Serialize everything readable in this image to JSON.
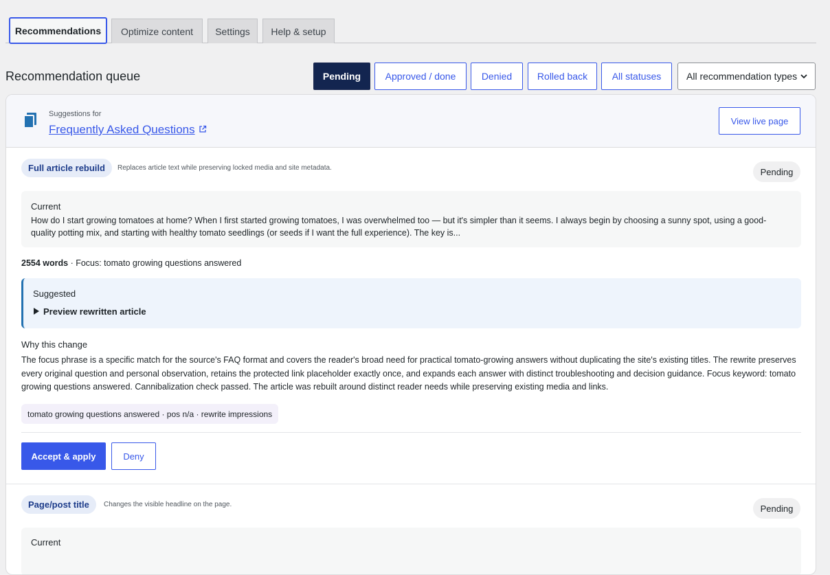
{
  "tabs": [
    {
      "label": "Recommendations",
      "active": true
    },
    {
      "label": "Optimize content",
      "active": false
    },
    {
      "label": "Settings",
      "active": false
    },
    {
      "label": "Help & setup",
      "active": false
    }
  ],
  "queue": {
    "title": "Recommendation queue",
    "filters": [
      {
        "label": "Pending",
        "active": true
      },
      {
        "label": "Approved / done",
        "active": false
      },
      {
        "label": "Denied",
        "active": false
      },
      {
        "label": "Rolled back",
        "active": false
      },
      {
        "label": "All statuses",
        "active": false
      }
    ],
    "type_select": {
      "value": "All recommendation types",
      "icon": "chevron-down-icon"
    }
  },
  "card": {
    "suggestions_for": "Suggestions for",
    "page_title": "Frequently Asked Questions",
    "page_icon": "copy-pages-icon",
    "view_live_label": "View live page",
    "recommendations": [
      {
        "type_label": "Full article rebuild",
        "type_desc": "Replaces article text while preserving locked media and site metadata.",
        "status": "Pending",
        "current_label": "Current",
        "current_text": "How do I start growing tomatoes at home? When I first started growing tomatoes, I was overwhelmed too — but it's simpler than it seems. I always begin by choosing a sunny spot, using a good-quality potting mix, and starting with healthy tomato seedlings (or seeds if I want the full experience). The key is...",
        "word_count": "2554 words",
        "focus": " · Focus: tomato growing questions answered",
        "suggested_label": "Suggested",
        "preview_label": "Preview rewritten article",
        "why_title": "Why this change",
        "why_text": "The focus phrase is a specific match for the source's FAQ format and covers the reader's broad need for practical tomato-growing answers without duplicating the site's existing titles. The rewrite preserves every original question and personal observation, retains the protected link placeholder exactly once, and expands each answer with distinct troubleshooting and decision guidance. Focus keyword: tomato growing questions answered. Cannibalization check passed. The article was rebuilt around distinct reader needs while preserving existing media and links.",
        "tag": "tomato growing questions answered · pos n/a · rewrite impressions",
        "accept_label": "Accept & apply",
        "deny_label": "Deny"
      },
      {
        "type_label": "Page/post title",
        "type_desc": "Changes the visible headline on the page.",
        "status": "Pending",
        "current_label": "Current"
      }
    ]
  },
  "colors": {
    "accent": "#3858e9",
    "active_filter_bg": "#132550",
    "page_bg": "#f0f0f1",
    "suggested_border": "#2271b1"
  }
}
